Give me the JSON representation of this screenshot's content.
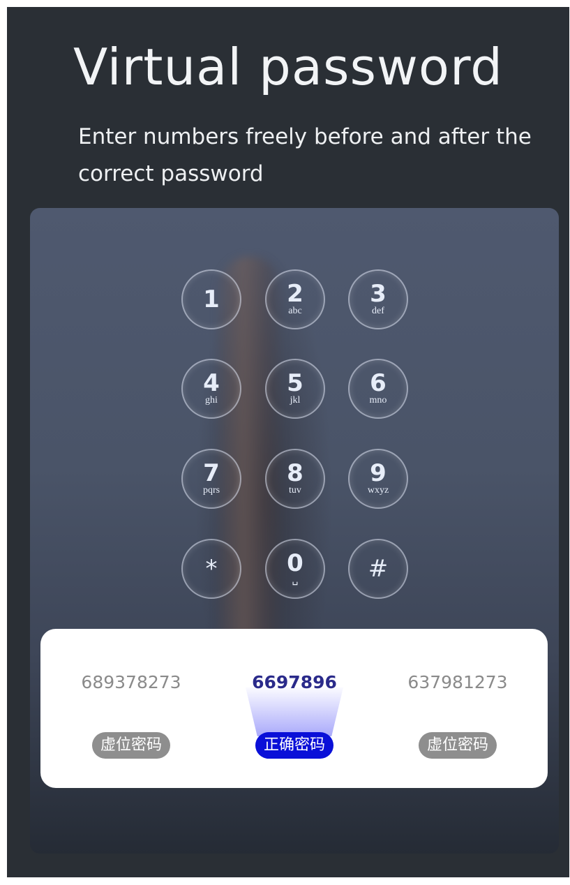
{
  "header": {
    "title": "Virtual password",
    "subtitle": "Enter numbers freely before and after the correct password"
  },
  "keypad": {
    "keys": [
      {
        "num": "1",
        "sub": ""
      },
      {
        "num": "2",
        "sub": "abc"
      },
      {
        "num": "3",
        "sub": "def"
      },
      {
        "num": "4",
        "sub": "ghi"
      },
      {
        "num": "5",
        "sub": "jkl"
      },
      {
        "num": "6",
        "sub": "mno"
      },
      {
        "num": "7",
        "sub": "pqrs"
      },
      {
        "num": "8",
        "sub": "tuv"
      },
      {
        "num": "9",
        "sub": "wxyz"
      },
      {
        "num": "*",
        "sub": ""
      },
      {
        "num": "0",
        "sub": "␣"
      },
      {
        "num": "#",
        "sub": ""
      }
    ]
  },
  "example": {
    "left": {
      "code": "689378273",
      "label": "虚位密码"
    },
    "center": {
      "code": "6697896",
      "label": "正确密码"
    },
    "right": {
      "code": "637981273",
      "label": "虚位密码"
    }
  },
  "colors": {
    "background": "#2a2f35",
    "correct_badge": "#0a10d8",
    "virtual_badge": "#8e8e8e"
  }
}
